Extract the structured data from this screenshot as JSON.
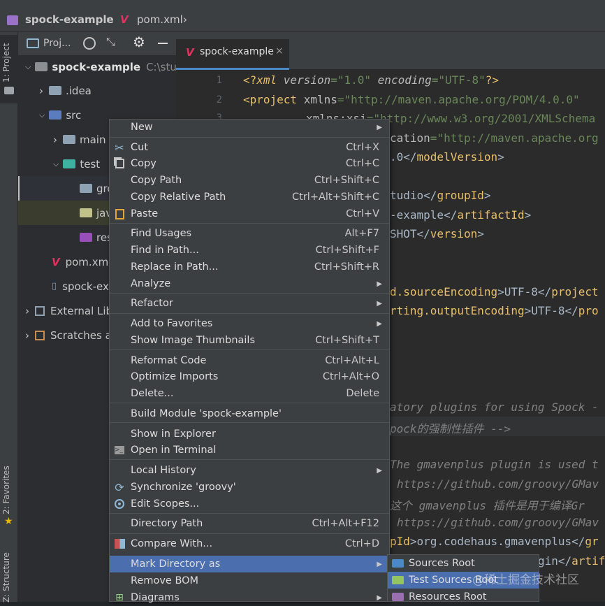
{
  "breadcrumb": {
    "project": "spock-example",
    "file": "pom.xml"
  },
  "side_tabs": {
    "project": "1: Project",
    "favorites": "2: Favorites",
    "structure": "Z: Structure"
  },
  "project_toolbar": {
    "view_label": "Proj..."
  },
  "tree": {
    "root": "spock-example",
    "root_path": "C:\\study",
    "idea": ".idea",
    "src": "src",
    "main": "main",
    "test": "test",
    "groovy": "gro",
    "java": "jav",
    "resources": "res",
    "pom": "pom.xml",
    "iml": "spock-ex",
    "external": "External Lib",
    "scratches": "Scratches a"
  },
  "editor_tab": {
    "label": "spock-example",
    "close": "×"
  },
  "line_numbers": [
    "1",
    "2",
    "3"
  ],
  "code": {
    "l1_a": "<?",
    "l1_b": "xml ",
    "l1_c": "version",
    "l1_d": "=\"1.0\" ",
    "l1_e": "encoding",
    "l1_f": "=\"UTF-8\"",
    "l1_g": "?>",
    "l2_a": "<project ",
    "l2_b": "xmlns",
    "l2_c": "=\"http://maven.apache.org/POM/4.0.0\"",
    "l3_a": "xmlns:xsi",
    "l3_b": "=\"http://www.w3.org/2001/XMLSchema",
    "l4_a": "cation",
    "l4_b": "=\"http://maven.apache.org",
    "l5_a": ".0</",
    "l5_b": "modelVersion",
    "l5_c": ">",
    "l6_a": "tudio</",
    "l6_b": "groupId",
    "l6_c": ">",
    "l7_a": "-example</",
    "l7_b": "artifactId",
    "l7_c": ">",
    "l8_a": "SHOT</",
    "l8_b": "version",
    "l8_c": ">",
    "l9_a": "d.sourceEncoding",
    "l9_b": ">UTF-8</",
    "l9_c": "project",
    "l10_a": "rting.outputEncoding",
    "l10_b": ">UTF-8</",
    "l10_c": "pro",
    "l11": "atory plugins for using Spock -",
    "l12": "pock的强制性插件 -->",
    "l13": "The gmavenplus plugin is used t",
    "l14": "https://github.com/groovy/GMav",
    "l15": "这个 gmavenplus 插件是用于编译Gr",
    "l16": "https://github.com/groovy/GMav",
    "l17_a": "pId",
    "l17_b": ">org.codehaus.gmavenplus</",
    "l17_c": "gr",
    "l18_a": "gin</",
    "l18_b": "artif"
  },
  "menu": [
    {
      "label": "New",
      "shortcut": "",
      "submenu": true
    },
    {
      "label": "Cut",
      "shortcut": "Ctrl+X",
      "icon": "scissors-icon"
    },
    {
      "label": "Copy",
      "shortcut": "Ctrl+C",
      "icon": "copy-icon"
    },
    {
      "label": "Copy Path",
      "shortcut": "Ctrl+Shift+C"
    },
    {
      "label": "Copy Relative Path",
      "shortcut": "Ctrl+Alt+Shift+C"
    },
    {
      "label": "Paste",
      "shortcut": "Ctrl+V",
      "icon": "clipboard-icon"
    },
    {
      "label": "Find Usages",
      "shortcut": "Alt+F7"
    },
    {
      "label": "Find in Path...",
      "shortcut": "Ctrl+Shift+F"
    },
    {
      "label": "Replace in Path...",
      "shortcut": "Ctrl+Shift+R"
    },
    {
      "label": "Analyze",
      "shortcut": "",
      "submenu": true
    },
    {
      "label": "Refactor",
      "shortcut": "",
      "submenu": true
    },
    {
      "label": "Add to Favorites",
      "shortcut": "",
      "submenu": true
    },
    {
      "label": "Show Image Thumbnails",
      "shortcut": "Ctrl+Shift+T"
    },
    {
      "label": "Reformat Code",
      "shortcut": "Ctrl+Alt+L"
    },
    {
      "label": "Optimize Imports",
      "shortcut": "Ctrl+Alt+O"
    },
    {
      "label": "Delete...",
      "shortcut": "Delete"
    },
    {
      "label": "Build Module 'spock-example'",
      "shortcut": ""
    },
    {
      "label": "Show in Explorer",
      "shortcut": ""
    },
    {
      "label": "Open in Terminal",
      "shortcut": "",
      "icon": "terminal-icon"
    },
    {
      "label": "Local History",
      "shortcut": "",
      "submenu": true
    },
    {
      "label": "Synchronize 'groovy'",
      "shortcut": "",
      "icon": "sync-icon"
    },
    {
      "label": "Edit Scopes...",
      "shortcut": "",
      "icon": "scope-icon"
    },
    {
      "label": "Directory Path",
      "shortcut": "Ctrl+Alt+F12"
    },
    {
      "label": "Compare With...",
      "shortcut": "Ctrl+D",
      "icon": "compare-icon"
    },
    {
      "label": "Mark Directory as",
      "shortcut": "",
      "submenu": true,
      "selected": true
    },
    {
      "label": "Remove BOM",
      "shortcut": ""
    },
    {
      "label": "Diagrams",
      "shortcut": "",
      "submenu": true,
      "icon": "diagram-icon"
    }
  ],
  "submenu": [
    {
      "label": "Sources Root",
      "color": "#4a88c7"
    },
    {
      "label": "Test Sources Root",
      "color": "#94c45d",
      "selected": true
    },
    {
      "label": "Resources Root",
      "color": "#9a6fb0"
    }
  ],
  "watermark": "@稀土掘金技术社区",
  "colors": {
    "selection": "#4b6eaf",
    "editor_bg": "#2b2b2b",
    "menu_bg": "#3c3f41"
  }
}
